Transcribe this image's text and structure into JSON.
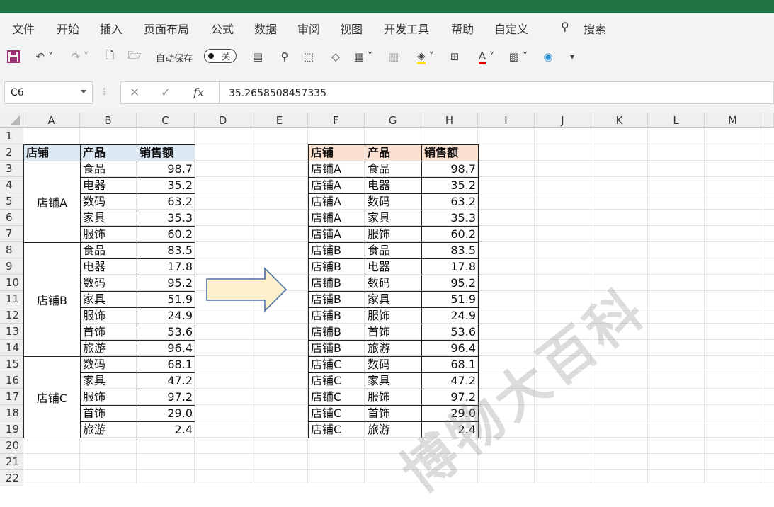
{
  "ribbon_tabs": [
    "文件",
    "开始",
    "插入",
    "页面布局",
    "公式",
    "数据",
    "审阅",
    "视图",
    "开发工具",
    "帮助",
    "自定义"
  ],
  "search_label": "搜索",
  "toolbar": {
    "autosave_label": "自动保存",
    "autosave_state": "关"
  },
  "name_box": "C6",
  "formula_value": "35.2658508457335",
  "fx_label": "fx",
  "columns": [
    "A",
    "B",
    "C",
    "D",
    "E",
    "F",
    "G",
    "H",
    "I",
    "J",
    "K",
    "L",
    "M"
  ],
  "rows": [
    "1",
    "2",
    "3",
    "4",
    "5",
    "6",
    "7",
    "8",
    "9",
    "10",
    "11",
    "12",
    "13",
    "14",
    "15",
    "16",
    "17",
    "18",
    "19",
    "20",
    "21",
    "22"
  ],
  "headers": [
    "店铺",
    "产品",
    "销售额"
  ],
  "source": {
    "groups": [
      {
        "store": "店铺A",
        "items": [
          [
            "食品",
            "98.7"
          ],
          [
            "电器",
            "35.2"
          ],
          [
            "数码",
            "63.2"
          ],
          [
            "家具",
            "35.3"
          ],
          [
            "服饰",
            "60.2"
          ]
        ]
      },
      {
        "store": "店铺B",
        "items": [
          [
            "食品",
            "83.5"
          ],
          [
            "电器",
            "17.8"
          ],
          [
            "数码",
            "95.2"
          ],
          [
            "家具",
            "51.9"
          ],
          [
            "服饰",
            "24.9"
          ],
          [
            "首饰",
            "53.6"
          ],
          [
            "旅游",
            "96.4"
          ]
        ]
      },
      {
        "store": "店铺C",
        "items": [
          [
            "数码",
            "68.1"
          ],
          [
            "家具",
            "47.2"
          ],
          [
            "服饰",
            "97.2"
          ],
          [
            "首饰",
            "29.0"
          ],
          [
            "旅游",
            "2.4"
          ]
        ]
      }
    ]
  },
  "result": [
    [
      "店铺A",
      "食品",
      "98.7"
    ],
    [
      "店铺A",
      "电器",
      "35.2"
    ],
    [
      "店铺A",
      "数码",
      "63.2"
    ],
    [
      "店铺A",
      "家具",
      "35.3"
    ],
    [
      "店铺A",
      "服饰",
      "60.2"
    ],
    [
      "店铺B",
      "食品",
      "83.5"
    ],
    [
      "店铺B",
      "电器",
      "17.8"
    ],
    [
      "店铺B",
      "数码",
      "95.2"
    ],
    [
      "店铺B",
      "家具",
      "51.9"
    ],
    [
      "店铺B",
      "服饰",
      "24.9"
    ],
    [
      "店铺B",
      "首饰",
      "53.6"
    ],
    [
      "店铺B",
      "旅游",
      "96.4"
    ],
    [
      "店铺C",
      "数码",
      "68.1"
    ],
    [
      "店铺C",
      "家具",
      "47.2"
    ],
    [
      "店铺C",
      "服饰",
      "97.2"
    ],
    [
      "店铺C",
      "首饰",
      "29.0"
    ],
    [
      "店铺C",
      "旅游",
      "2.4"
    ]
  ],
  "watermark": "博物大百科",
  "colors": {
    "excel_green": "#217346",
    "header_blue": "#dde8f5",
    "header_orange": "#fce0d0",
    "arrow_fill": "#fdf0cc",
    "arrow_stroke": "#4a6fa5"
  }
}
